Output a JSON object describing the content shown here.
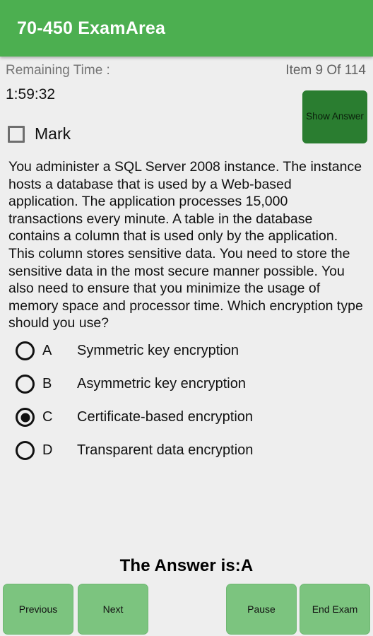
{
  "appbar": {
    "title": "70-450 ExamArea"
  },
  "status": {
    "remaining_time_label": "Remaining Time :",
    "item_counter": "Item 9 Of 114"
  },
  "timer": {
    "value": "1:59:32"
  },
  "mark": {
    "label": "Mark",
    "checked": false
  },
  "show_answer": {
    "label": "Show Answer"
  },
  "question": {
    "text": "You administer a SQL Server 2008 instance. The instance hosts a database that is used by a Web-based application. The application processes 15,000 transactions every minute. A table in the database contains a column that is used only by the application. This column stores sensitive data. You need to store the sensitive data in the most secure manner possible. You also need to ensure that you minimize the usage of memory space and processor time. Which encryption type should you use?"
  },
  "options": [
    {
      "letter": "A",
      "text": "Symmetric key encryption",
      "selected": false
    },
    {
      "letter": "B",
      "text": "Asymmetric key encryption",
      "selected": false
    },
    {
      "letter": "C",
      "text": "Certificate-based encryption",
      "selected": true
    },
    {
      "letter": "D",
      "text": "Transparent data encryption",
      "selected": false
    }
  ],
  "answer_banner": {
    "text": "The Answer is:A"
  },
  "buttons": {
    "previous": "Previous",
    "next": "Next",
    "pause": "Pause",
    "end_exam": "End Exam"
  },
  "colors": {
    "appbar_green": "#4caf50",
    "show_answer_green": "#2a7d30",
    "nav_button_green": "#7cc47f",
    "page_background": "#eeeeee",
    "muted_text": "#757575"
  }
}
